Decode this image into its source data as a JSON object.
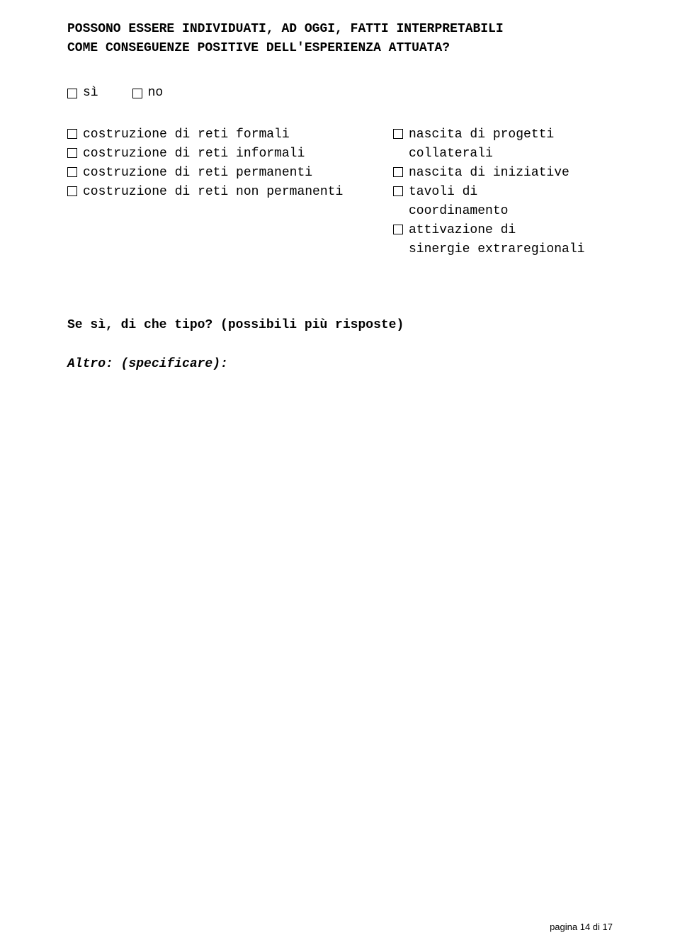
{
  "question": {
    "line1": "POSSONO ESSERE INDIVIDUATI, AD OGGI, FATTI INTERPRETABILI",
    "line2": "COME CONSEGUENZE POSITIVE DELL'ESPERIENZA ATTUATA?"
  },
  "yn": {
    "si": "sì",
    "no": "no"
  },
  "left_options": [
    "costruzione di reti formali",
    "costruzione di reti informali",
    "costruzione di reti permanenti",
    "costruzione di reti non permanenti"
  ],
  "right_options": [
    {
      "label": "nascita di progetti",
      "cont": "collaterali"
    },
    {
      "label": "nascita di iniziative",
      "cont": null
    },
    {
      "label": "tavoli di",
      "cont": "coordinamento"
    },
    {
      "label": "attivazione di",
      "cont": "sinergie extraregionali"
    }
  ],
  "subq": "Se sì, di che tipo? (possibili più risposte)",
  "altro_label": "Altro: (specificare):",
  "footer": "pagina 14 di 17"
}
